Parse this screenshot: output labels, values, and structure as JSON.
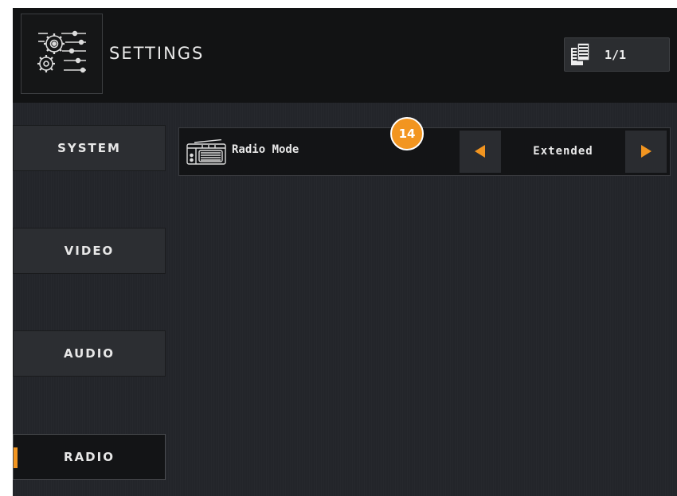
{
  "header": {
    "title": "SETTINGS",
    "logo_icon": "settings-gears-sliders-icon",
    "page_icon": "pages-icon",
    "page_indicator": "1/1"
  },
  "sidebar": {
    "items": [
      {
        "label": "SYSTEM",
        "active": false
      },
      {
        "label": "VIDEO",
        "active": false
      },
      {
        "label": "AUDIO",
        "active": false
      },
      {
        "label": "RADIO",
        "active": true
      }
    ]
  },
  "settings_row": {
    "icon": "radio-icon",
    "label": "Radio Mode",
    "value": "Extended",
    "prev_icon": "arrow-left-icon",
    "next_icon": "arrow-right-icon"
  },
  "annotation": {
    "badge_number": "14"
  },
  "colors": {
    "accent": "#f29520",
    "background": "#23252a",
    "header": "#121314"
  }
}
